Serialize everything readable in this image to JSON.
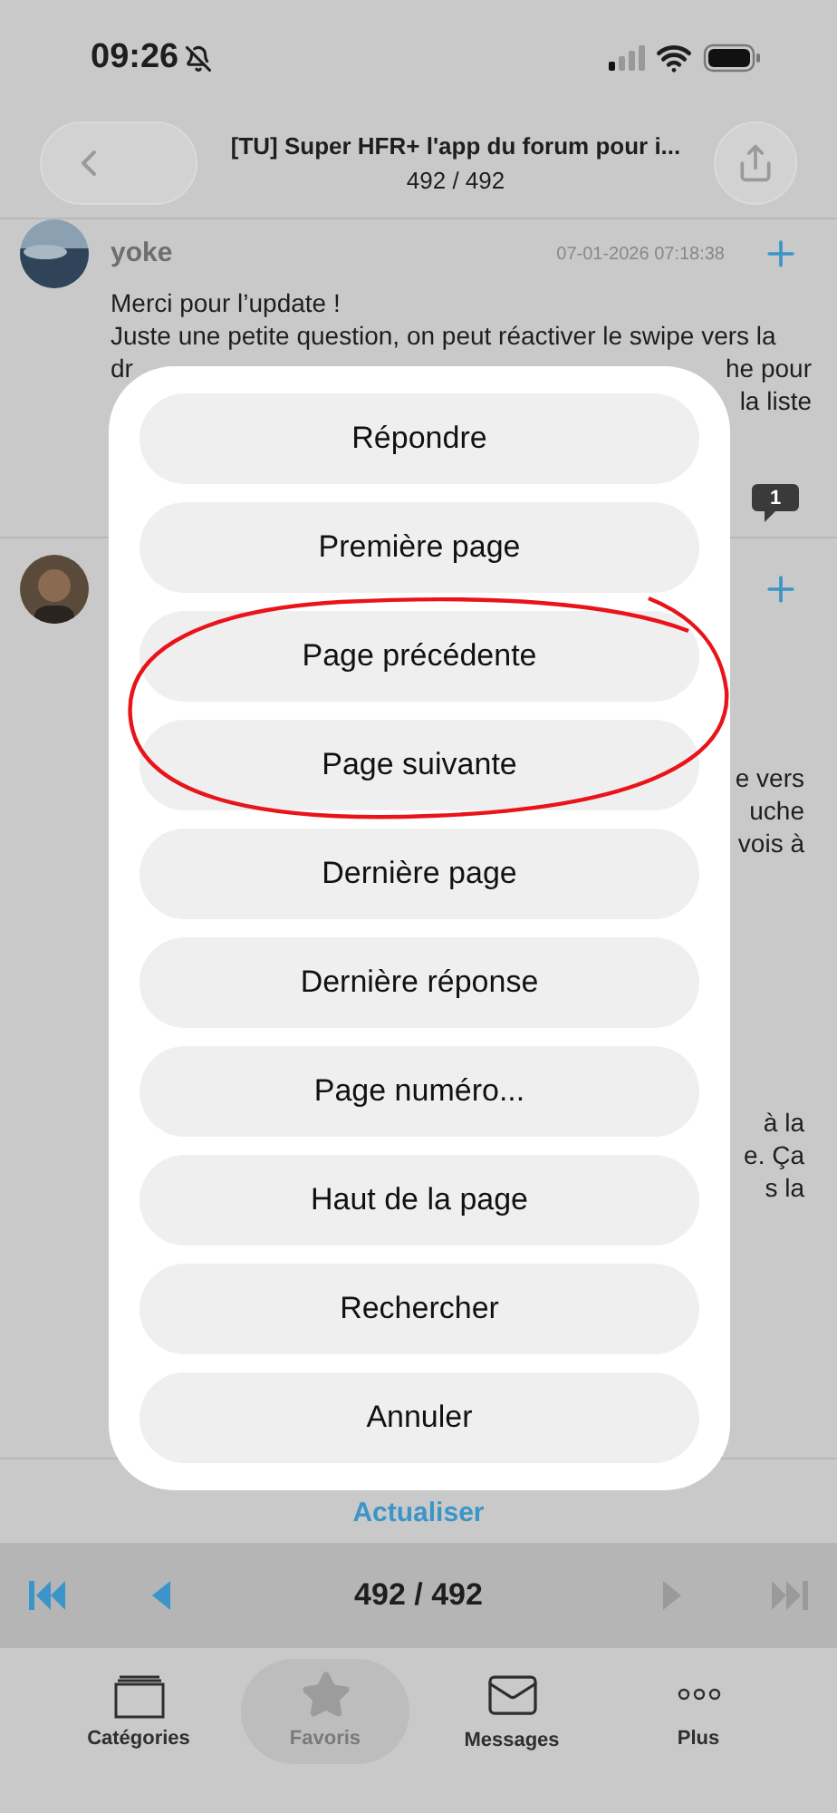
{
  "status_bar": {
    "time": "09:26"
  },
  "nav": {
    "title": "[TU] Super HFR+ l'app du forum pour i...",
    "subtitle": "492 / 492"
  },
  "posts": [
    {
      "author": "yoke",
      "date": "07-01-2026 07:18:38",
      "badge": "1",
      "blocks": [
        [
          {
            "left": "Merci pour l’update !"
          },
          {
            "left": "Juste une petite question, on peut réactiver le swipe vers la"
          },
          {
            "left": "dr",
            "right": "he pour"
          },
          {
            "right": "la liste"
          }
        ]
      ]
    },
    {
      "blocks": [
        [
          {
            "right": "e vers"
          },
          {
            "right": "uche"
          },
          {
            "right": "vois à"
          }
        ],
        [
          {
            "right": "à la"
          },
          {
            "right": "e. Ça"
          },
          {
            "right": "s la"
          }
        ]
      ]
    }
  ],
  "refresh": "Actualiser",
  "pager": {
    "label": "492 / 492",
    "first_disabled": false,
    "prev_disabled": false,
    "next_disabled": true,
    "last_disabled": true
  },
  "tabs": [
    {
      "label": "Catégories",
      "selected": false
    },
    {
      "label": "Favoris",
      "selected": true
    },
    {
      "label": "Messages",
      "selected": false
    },
    {
      "label": "Plus",
      "selected": false
    }
  ],
  "actions": [
    "Répondre",
    "Première page",
    "Page précédente",
    "Page suivante",
    "Dernière page",
    "Dernière réponse",
    "Page numéro...",
    "Haut de la page",
    "Rechercher",
    "Annuler"
  ]
}
